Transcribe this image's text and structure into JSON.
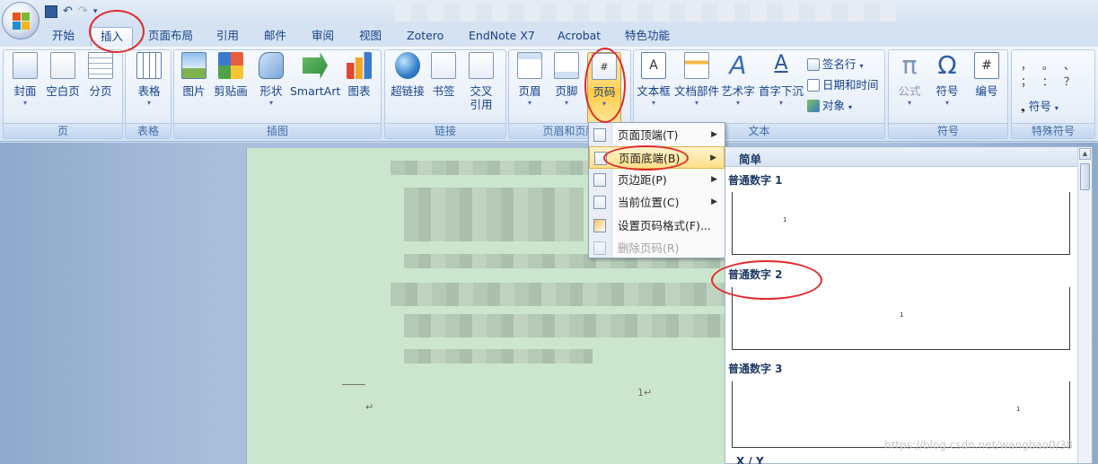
{
  "qat": {
    "save_icon": "save-icon",
    "undo_icon": "undo-icon",
    "redo_icon": "redo-icon",
    "customize_icon": "customize-qat-icon"
  },
  "tabs": [
    {
      "label": "开始"
    },
    {
      "label": "插入"
    },
    {
      "label": "页面布局"
    },
    {
      "label": "引用"
    },
    {
      "label": "邮件"
    },
    {
      "label": "审阅"
    },
    {
      "label": "视图"
    },
    {
      "label": "Zotero"
    },
    {
      "label": "EndNote X7"
    },
    {
      "label": "Acrobat"
    },
    {
      "label": "特色功能"
    }
  ],
  "active_tab": "插入",
  "groups": {
    "pages": {
      "label": "页",
      "buttons": [
        "封面",
        "空白页",
        "分页"
      ]
    },
    "tables": {
      "label": "表格",
      "buttons": [
        "表格"
      ]
    },
    "illustrations": {
      "label": "插图",
      "buttons": [
        "图片",
        "剪贴画",
        "形状",
        "SmartArt",
        "图表"
      ]
    },
    "links": {
      "label": "链接",
      "buttons": [
        "超链接",
        "书签",
        "交叉",
        "引用"
      ]
    },
    "header_footer": {
      "label": "页眉和页脚",
      "buttons": [
        "页眉",
        "页脚",
        "页码"
      ]
    },
    "text": {
      "label": "文本",
      "buttons": [
        "文本框",
        "文档部件",
        "艺术字",
        "首字下沉"
      ],
      "small": [
        "签名行",
        "日期和时间",
        "对象"
      ]
    },
    "symbols": {
      "label": "符号",
      "buttons": [
        "公式",
        "符号",
        "编号"
      ]
    },
    "special": {
      "label": "特殊符号",
      "chars": [
        "，",
        "。",
        "、",
        "；",
        "：",
        "？"
      ],
      "button": "符号"
    }
  },
  "page_number_menu": [
    {
      "label": "页面顶端(T)",
      "submenu": true,
      "disabled": false
    },
    {
      "label": "页面底端(B)",
      "submenu": true,
      "disabled": false
    },
    {
      "label": "页边距(P)",
      "submenu": true,
      "disabled": false
    },
    {
      "label": "当前位置(C)",
      "submenu": true,
      "disabled": false
    },
    {
      "label": "设置页码格式(F)...",
      "submenu": false,
      "disabled": false
    },
    {
      "label": "删除页码(R)",
      "submenu": false,
      "disabled": true
    }
  ],
  "gallery": {
    "section": "简单",
    "items": [
      {
        "label": "普通数字 1",
        "number": "1"
      },
      {
        "label": "普通数字 2",
        "number": "1"
      },
      {
        "label": "普通数字 3",
        "number": "1"
      }
    ],
    "partial_label": "X / Y"
  },
  "document": {
    "page_number": "1↵",
    "return_mark": "↵"
  },
  "watermark": "https://blog.csdn.net/wangbao0/38"
}
